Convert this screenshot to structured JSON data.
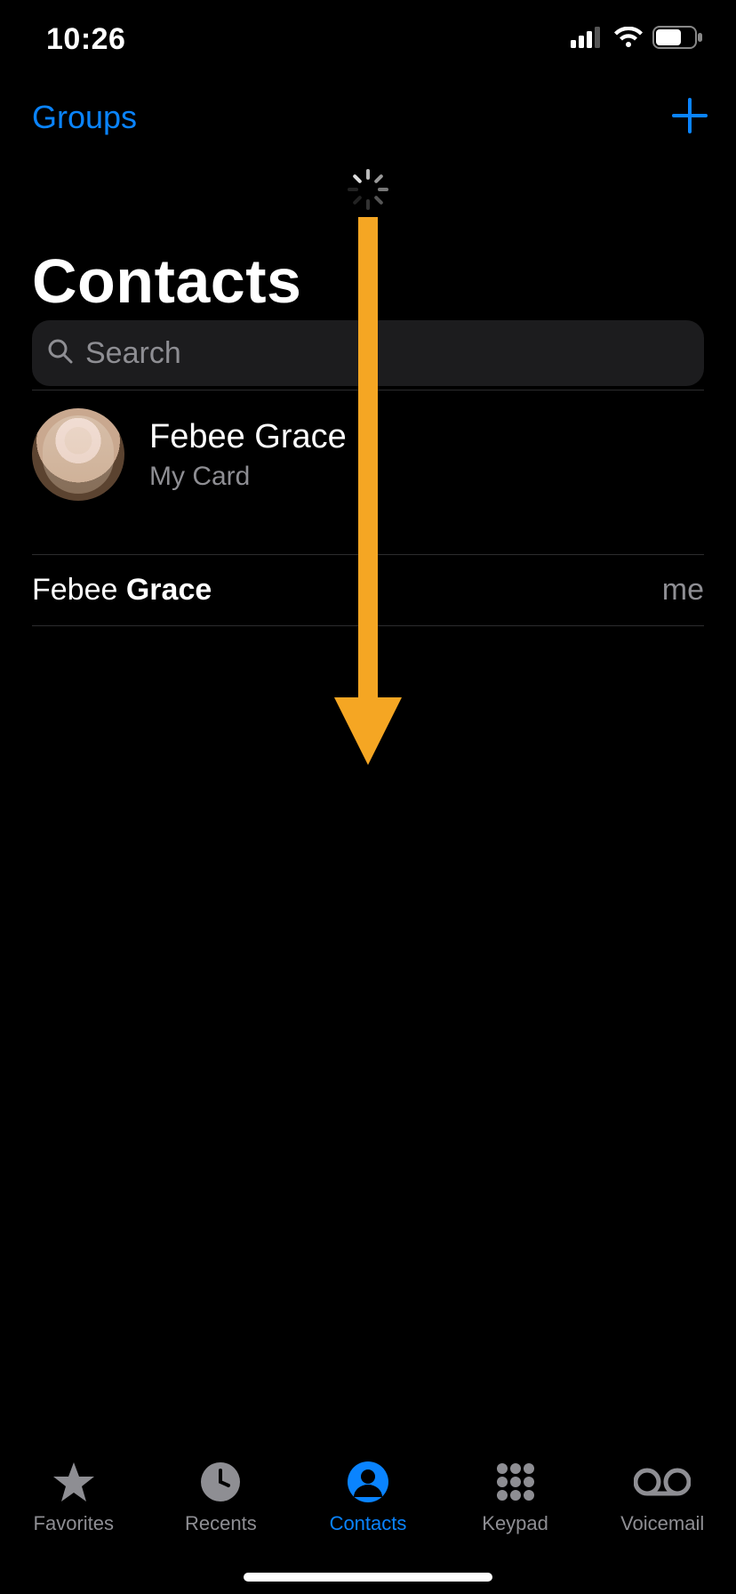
{
  "status_bar": {
    "time": "10:26"
  },
  "nav": {
    "left_label": "Groups",
    "add_icon": "plus-icon"
  },
  "page": {
    "title": "Contacts"
  },
  "search": {
    "placeholder": "Search",
    "value": ""
  },
  "my_card": {
    "name": "Febee Grace",
    "subtitle": "My Card"
  },
  "contacts": [
    {
      "first": "Febee",
      "last": "Grace",
      "tag": "me"
    }
  ],
  "tabs": [
    {
      "id": "favorites",
      "label": "Favorites",
      "active": false
    },
    {
      "id": "recents",
      "label": "Recents",
      "active": false
    },
    {
      "id": "contacts",
      "label": "Contacts",
      "active": true
    },
    {
      "id": "keypad",
      "label": "Keypad",
      "active": false
    },
    {
      "id": "voicemail",
      "label": "Voicemail",
      "active": false
    }
  ],
  "annotation": {
    "arrow_color": "#f5a623"
  }
}
